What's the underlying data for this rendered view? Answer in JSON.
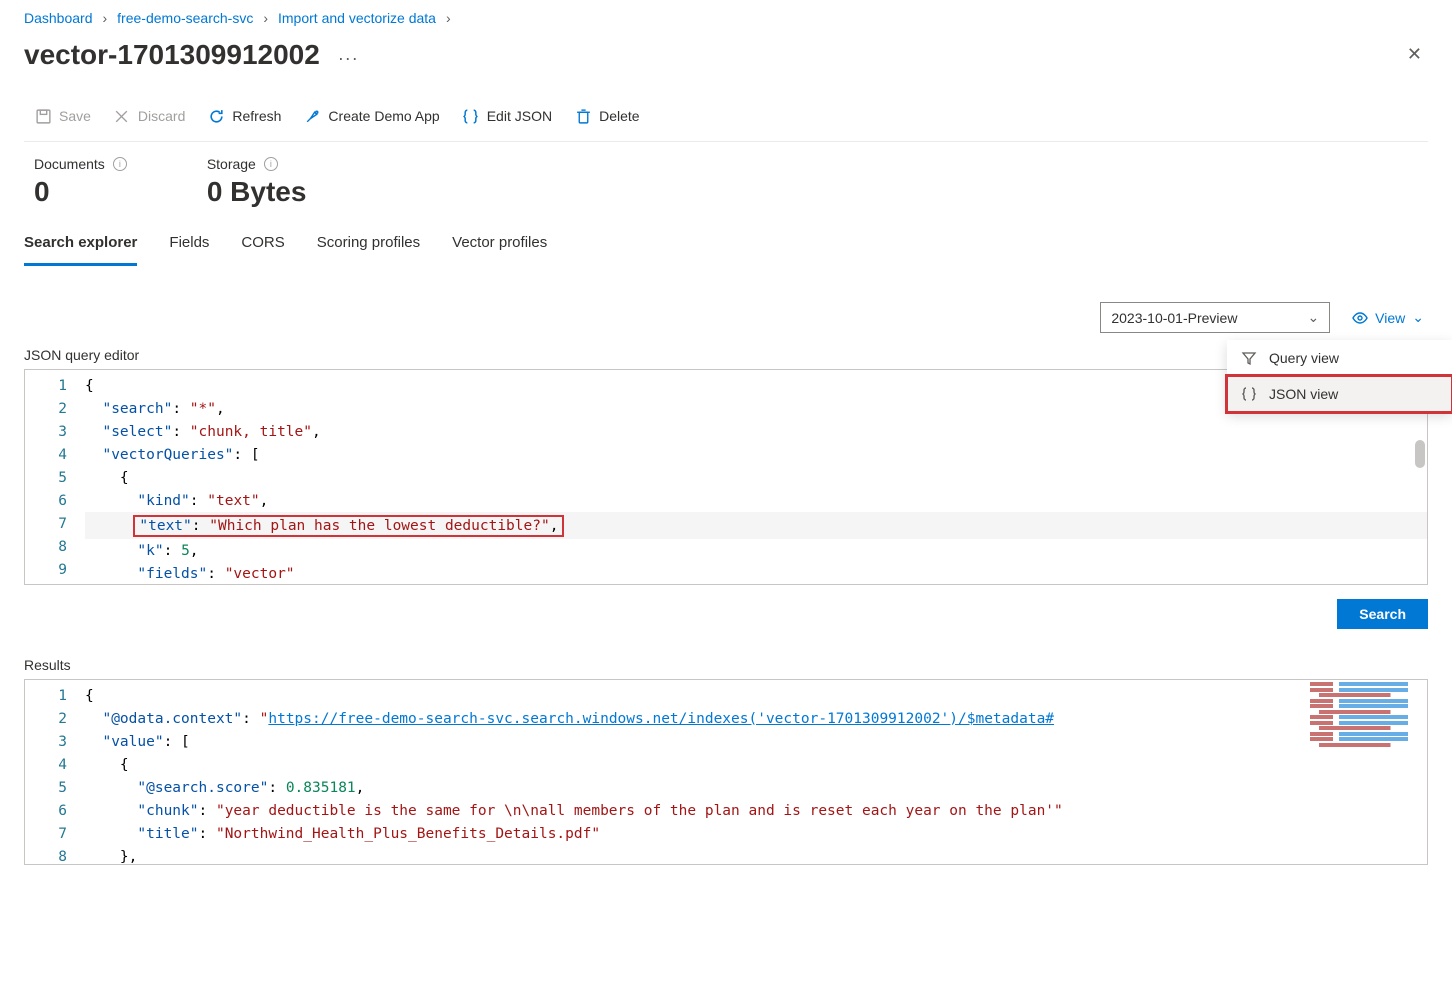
{
  "breadcrumb": [
    "Dashboard",
    "free-demo-search-svc",
    "Import and vectorize data"
  ],
  "page_title": "vector-1701309912002",
  "toolbar": {
    "save": "Save",
    "discard": "Discard",
    "refresh": "Refresh",
    "create_demo": "Create Demo App",
    "edit_json": "Edit JSON",
    "delete": "Delete"
  },
  "stats": {
    "documents_label": "Documents",
    "documents_value": "0",
    "storage_label": "Storage",
    "storage_value": "0 Bytes"
  },
  "tabs": [
    "Search explorer",
    "Fields",
    "CORS",
    "Scoring profiles",
    "Vector profiles"
  ],
  "api_version": "2023-10-01-Preview",
  "view_label": "View",
  "dropdown": {
    "query_view": "Query view",
    "json_view": "JSON view"
  },
  "json_editor_label": "JSON query editor",
  "query": {
    "search": "*",
    "select": "chunk, title",
    "kind": "text",
    "text": "Which plan has the lowest deductible?",
    "k": 5,
    "fields": "vector"
  },
  "search_button": "Search",
  "results_label": "Results",
  "results": {
    "odata_context_url": "https://free-demo-search-svc.search.windows.net/indexes('vector-1701309912002')/$metadata#",
    "score": 0.835181,
    "chunk": "year deductible is the same for \\n\\nall members of the plan and is reset each year on the plan'",
    "title": "Northwind_Health_Plus_Benefits_Details.pdf"
  }
}
